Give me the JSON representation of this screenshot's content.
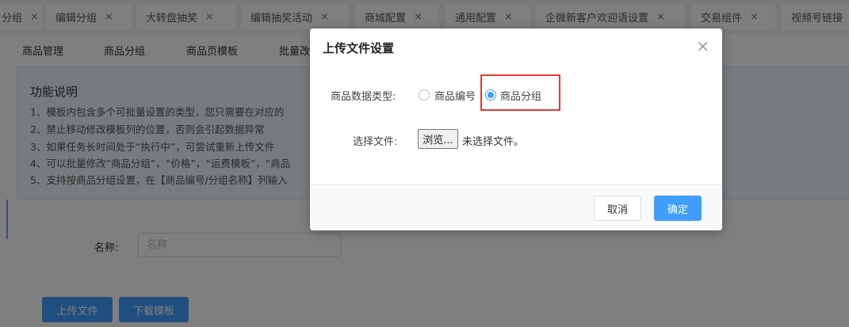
{
  "tabs": [
    {
      "label": "分组",
      "close": "×"
    },
    {
      "label": "编辑分组",
      "close": "×"
    },
    {
      "label": "大转盘抽奖",
      "close": "×"
    },
    {
      "label": "编辑抽奖活动",
      "close": "×"
    },
    {
      "label": "商城配置",
      "close": "×"
    },
    {
      "label": "通用配置",
      "close": "×"
    },
    {
      "label": "企微新客户欢迎语设置",
      "close": "×"
    },
    {
      "label": "交易组件",
      "close": "×"
    },
    {
      "label": "视频号链接",
      "close": ""
    }
  ],
  "subnav": [
    "商品管理",
    "商品分组",
    "商品页模板",
    "批量改"
  ],
  "info": {
    "title": "功能说明",
    "lines": [
      "1、模板内包含多个可批量设置的类型，您只需要在对应的",
      "2、禁止移动修改模板列的位置，否则会引起数据异常",
      "3、如果任务长时间处于“执行中”，可尝试重新上传文件",
      "4、可以批量修改“商品分组”，“价格”，“运费模板”，“商品",
      "5、支持按商品分组设置，在【商品编号/分组名称】列输入"
    ]
  },
  "form": {
    "name_label": "名称:",
    "name_placeholder": "名称",
    "upload_button": "上传文件",
    "download_button": "下载模板"
  },
  "modal": {
    "title": "上传文件设置",
    "close": "×",
    "data_type_label": "商品数据类型:",
    "options": [
      {
        "label": "商品编号",
        "checked": false
      },
      {
        "label": "商品分组",
        "checked": true
      }
    ],
    "file_label": "选择文件:",
    "browse_button": "浏览...",
    "file_status": "未选择文件。",
    "cancel_button": "取消",
    "confirm_button": "确定"
  },
  "colors": {
    "primary": "#409eff",
    "highlight": "#e53935"
  }
}
